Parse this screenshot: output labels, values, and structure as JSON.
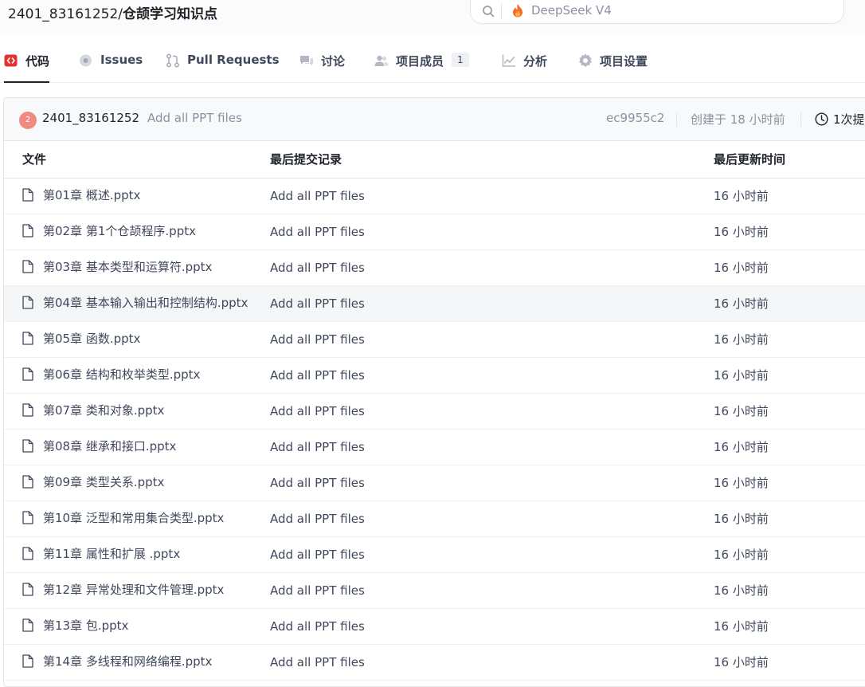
{
  "repo": {
    "owner": "2401_83161252",
    "separator": "/",
    "name": "仓颉学习知识点"
  },
  "search": {
    "hint": "DeepSeek V4"
  },
  "tabs": [
    {
      "label": "代码",
      "icon": "code-icon",
      "active": true
    },
    {
      "label": "Issues",
      "icon": "issues-icon"
    },
    {
      "label": "Pull Requests",
      "icon": "pull-request-icon"
    },
    {
      "label": "讨论",
      "icon": "discussion-icon"
    },
    {
      "label": "项目成员",
      "icon": "members-icon",
      "badge": "1"
    },
    {
      "label": "分析",
      "icon": "analytics-icon"
    },
    {
      "label": "项目设置",
      "icon": "settings-gear-icon"
    }
  ],
  "commit": {
    "avatar_text": "2",
    "author": "2401_83161252",
    "message": "Add all PPT files",
    "hash": "ec9955c2",
    "created": "创建于 18 小时前",
    "count_text": "1次提"
  },
  "table": {
    "headers": {
      "name": "文件",
      "commit": "最后提交记录",
      "time": "最后更新时间"
    },
    "rows": [
      {
        "name": "第01章 概述.pptx",
        "commit": "Add all PPT files",
        "time": "16 小时前"
      },
      {
        "name": "第02章 第1个仓颉程序.pptx",
        "commit": "Add all PPT files",
        "time": "16 小时前"
      },
      {
        "name": "第03章 基本类型和运算符.pptx",
        "commit": "Add all PPT files",
        "time": "16 小时前"
      },
      {
        "name": "第04章 基本输入输出和控制结构.pptx",
        "commit": "Add all PPT files",
        "time": "16 小时前"
      },
      {
        "name": "第05章 函数.pptx",
        "commit": "Add all PPT files",
        "time": "16 小时前"
      },
      {
        "name": "第06章 结构和枚举类型.pptx",
        "commit": "Add all PPT files",
        "time": "16 小时前"
      },
      {
        "name": "第07章 类和对象.pptx",
        "commit": "Add all PPT files",
        "time": "16 小时前"
      },
      {
        "name": "第08章 继承和接口.pptx",
        "commit": "Add all PPT files",
        "time": "16 小时前"
      },
      {
        "name": "第09章 类型关系.pptx",
        "commit": "Add all PPT files",
        "time": "16 小时前"
      },
      {
        "name": "第10章 泛型和常用集合类型.pptx",
        "commit": "Add all PPT files",
        "time": "16 小时前"
      },
      {
        "name": "第11章 属性和扩展 .pptx",
        "commit": "Add all PPT files",
        "time": "16 小时前"
      },
      {
        "name": "第12章 异常处理和文件管理.pptx",
        "commit": "Add all PPT files",
        "time": "16 小时前"
      },
      {
        "name": "第13章 包.pptx",
        "commit": "Add all PPT files",
        "time": "16 小时前"
      },
      {
        "name": "第14章 多线程和网络编程.pptx",
        "commit": "Add all PPT files",
        "time": "16 小时前"
      }
    ]
  },
  "colors": {
    "accent_code": "#e5322e",
    "avatar": "#f08a80",
    "flame": "#f26b2b",
    "text": "#40485b",
    "muted": "#8a919f"
  }
}
